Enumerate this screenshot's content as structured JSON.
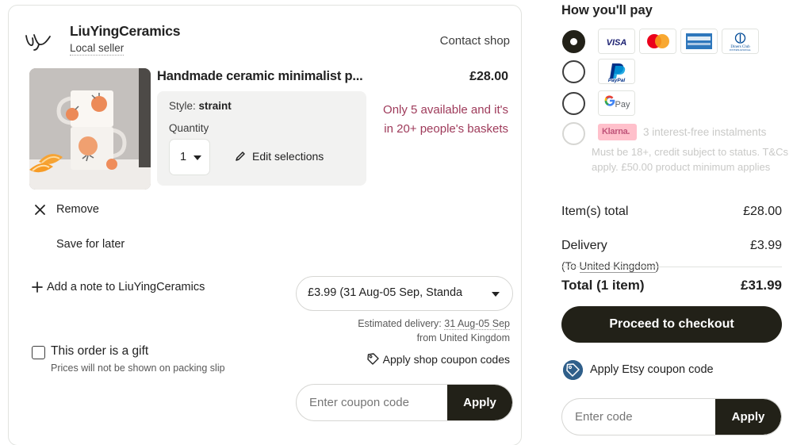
{
  "cart": {
    "shop": {
      "logo_icon": "handwritten-monogram-ly",
      "name": "LiuYingCeramics",
      "badge": "Local seller",
      "contact_label": "Contact shop"
    },
    "item": {
      "image_alt": "two-stacked-white-ceramic-mugs-with-orange-motif",
      "title": "Handmade ceramic minimalist p...",
      "price": "£28.00",
      "style_prefix": "Style:",
      "style_value": "straint",
      "quantity_label": "Quantity",
      "quantity_value": "1",
      "edit_selections_label": "Edit selections",
      "stock_warning": "Only 5 available and it's in 20+ people's baskets",
      "stock_warning_color": "#9e3a5a",
      "remove_label": "Remove",
      "save_for_later_label": "Save for later"
    },
    "add_note_label": "Add a note to LiuYingCeramics",
    "shipping": {
      "selected_option": "£3.99 (31 Aug-05 Sep, Standa",
      "estimated_prefix": "Estimated delivery:",
      "estimated_dates": "31 Aug-05 Sep",
      "estimated_from": "from United Kingdom"
    },
    "gift": {
      "checkbox_label": "This order is a gift",
      "sub_label": "Prices will not be shown on packing slip",
      "checked": false
    },
    "shop_coupon_label": "Apply shop coupon codes",
    "coupon": {
      "placeholder": "Enter coupon code",
      "value": "",
      "apply_label": "Apply"
    }
  },
  "summary": {
    "pay_title": "How you'll pay",
    "methods": [
      {
        "id": "credit-card",
        "selected": true,
        "disabled": false,
        "cards": [
          "visa",
          "mastercard",
          "american-express",
          "diners-club"
        ]
      },
      {
        "id": "paypal",
        "selected": false,
        "disabled": false,
        "chip": "PayPal"
      },
      {
        "id": "google-pay",
        "selected": false,
        "disabled": false,
        "chip": "G Pay"
      },
      {
        "id": "klarna",
        "selected": false,
        "disabled": true,
        "chip": "Klarna.",
        "text": "3 interest-free instalments",
        "note": "Must be 18+, credit subject to status. T&Cs apply. £50.00 product minimum applies"
      }
    ],
    "totals": {
      "items_label": "Item(s) total",
      "items_value": "£28.00",
      "delivery_label": "Delivery",
      "delivery_value": "£3.99",
      "delivery_sub_prefix": "(To ",
      "delivery_country": "United Kingdom",
      "delivery_sub_suffix": ")",
      "total_label": "Total (1 item)",
      "total_value": "£31.99"
    },
    "checkout_label": "Proceed to checkout",
    "etsy_coupon_label": "Apply Etsy coupon code",
    "code": {
      "placeholder": "Enter code",
      "value": "",
      "apply_label": "Apply"
    }
  }
}
